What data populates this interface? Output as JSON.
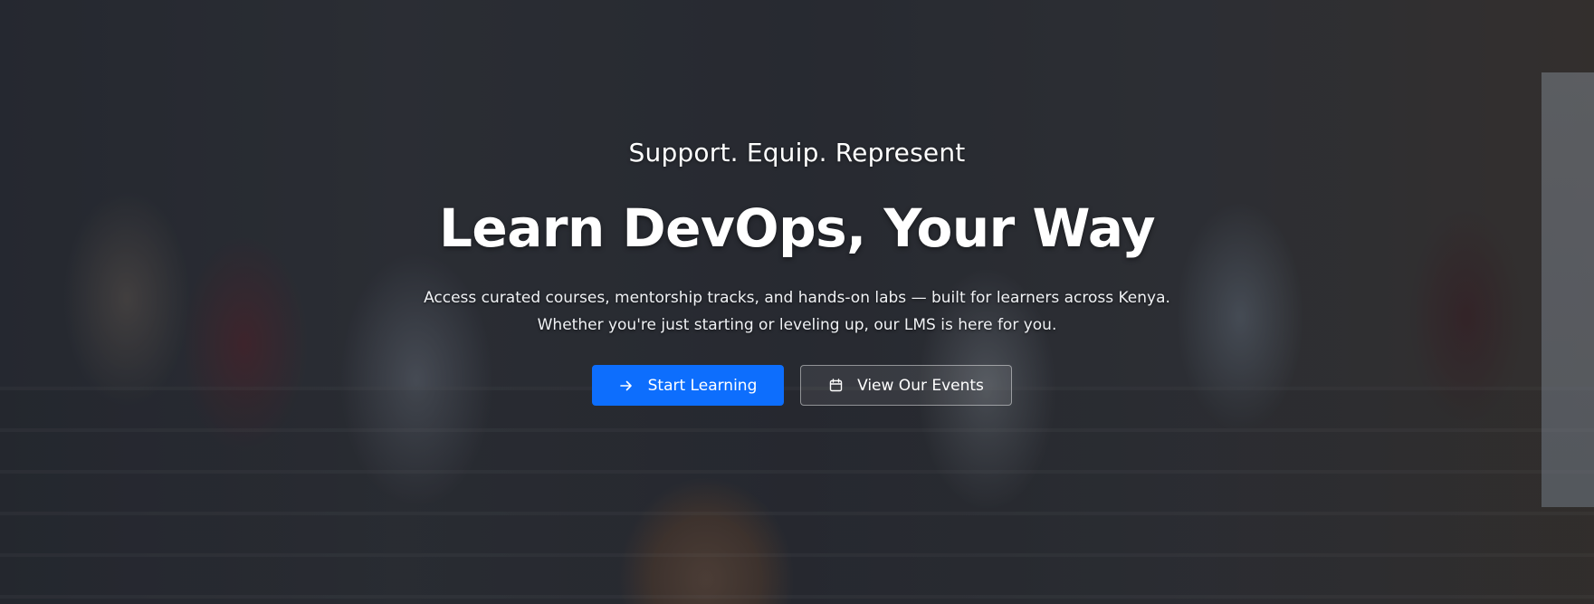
{
  "hero": {
    "eyebrow": "Support. Equip. Represent",
    "headline": "Learn DevOps, Your Way",
    "description_line1": "Access curated courses, mentorship tracks, and hands-on labs — built for learners across Kenya.",
    "description_line2": "Whether you're just starting or leveling up, our LMS is here for you.",
    "background_image": "group-photo-devopsdays-attendees"
  },
  "actions": {
    "primary": {
      "label": "Start Learning",
      "icon": "arrow-right-icon",
      "color": "#0d6efd"
    },
    "secondary": {
      "label": "View Our Events",
      "icon": "calendar-icon"
    }
  }
}
